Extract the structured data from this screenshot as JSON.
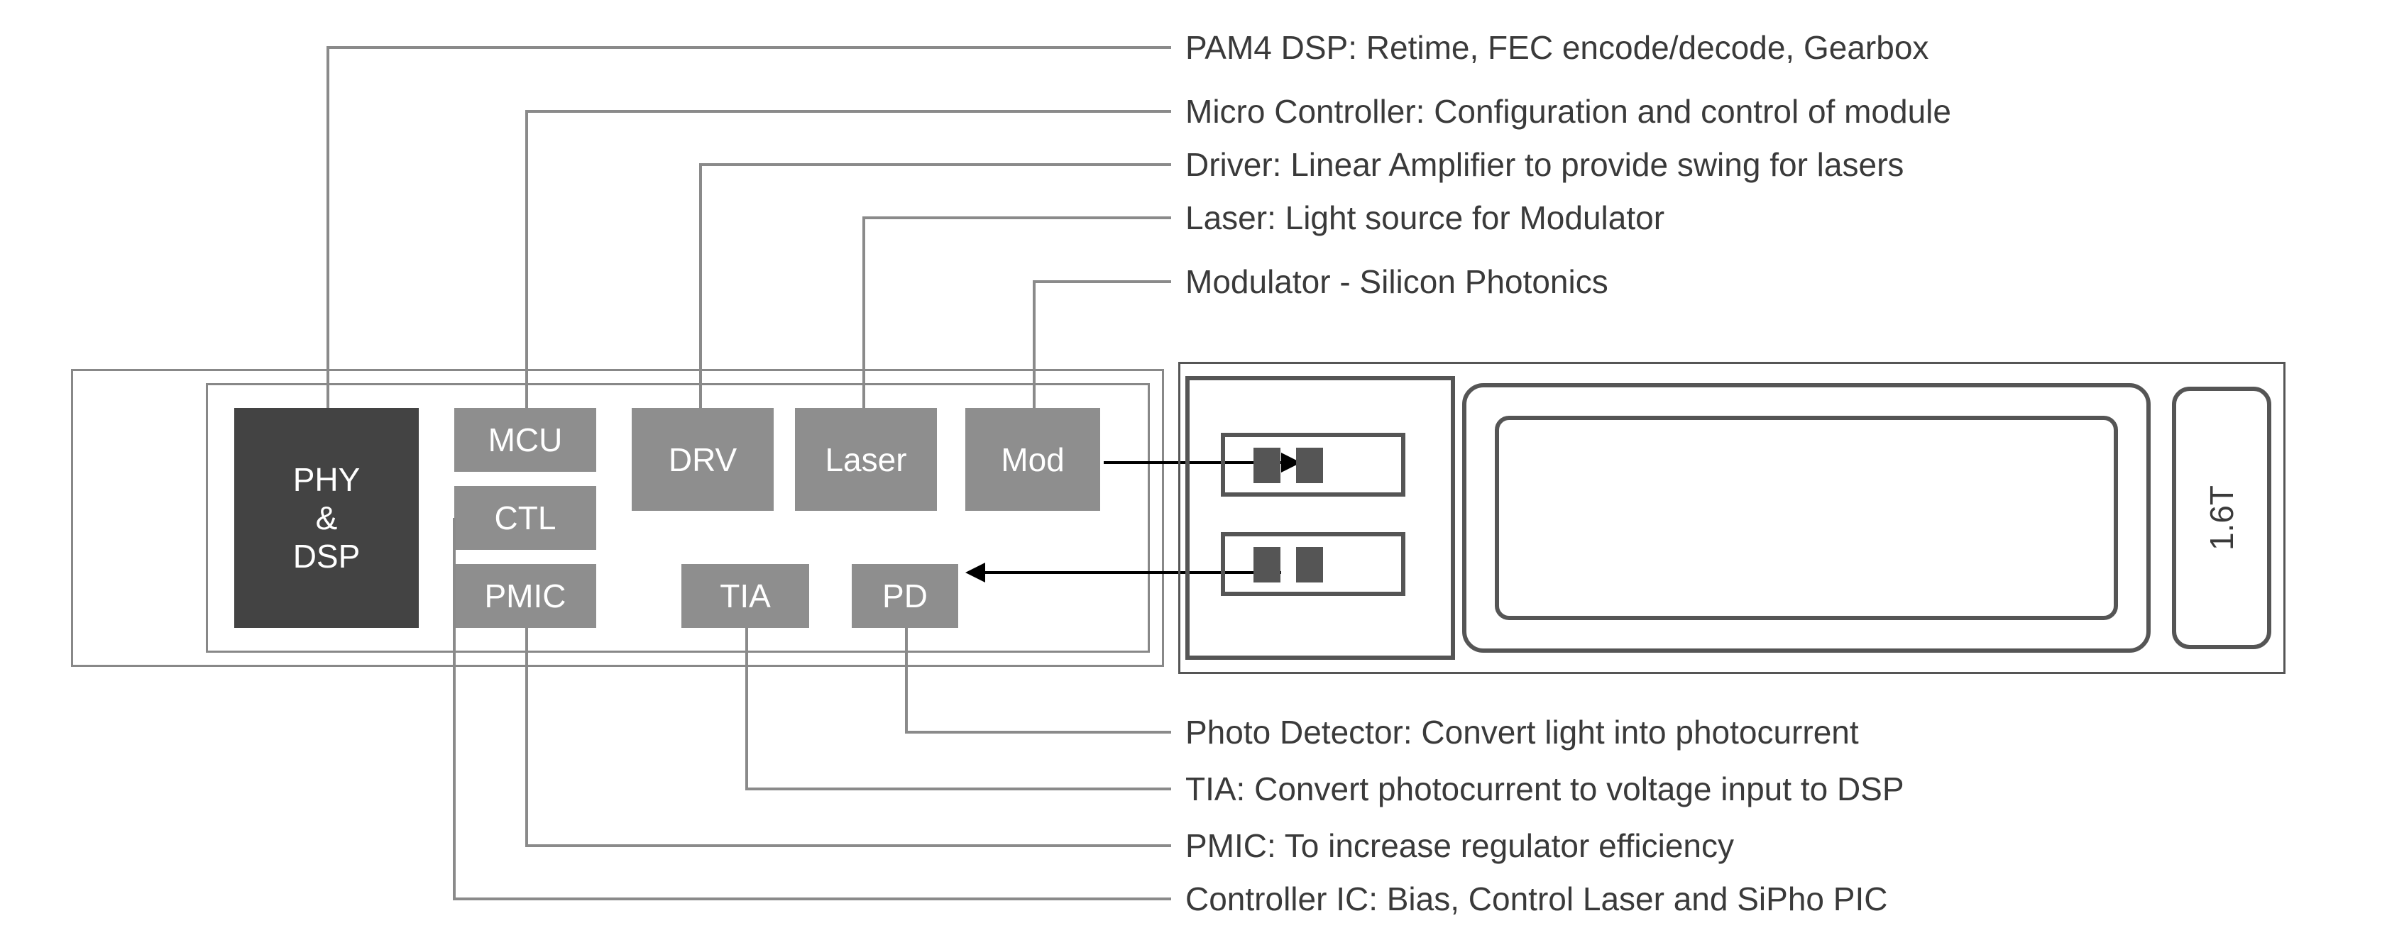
{
  "labels_top": {
    "dsp": "PAM4 DSP: Retime, FEC encode/decode, Gearbox",
    "mcu": "Micro Controller: Configuration and control of module",
    "driver": "Driver: Linear Amplifier to provide swing for lasers",
    "laser": "Laser: Light source for Modulator",
    "modulator": "Modulator - Silicon Photonics"
  },
  "labels_bottom": {
    "pd": "Photo Detector: Convert light into photocurrent",
    "tia": "TIA: Convert photocurrent to voltage input to DSP",
    "pmic": "PMIC: To increase regulator efficiency",
    "ctl": "Controller IC: Bias, Control Laser and SiPho PIC"
  },
  "blocks": {
    "phy_dsp": "PHY\n&\nDSP",
    "mcu": "MCU",
    "ctl": "CTL",
    "pmic": "PMIC",
    "drv": "DRV",
    "tia": "TIA",
    "laser": "Laser",
    "pd": "PD",
    "mod": "Mod"
  },
  "transceiver": {
    "rate": "1.6T"
  }
}
